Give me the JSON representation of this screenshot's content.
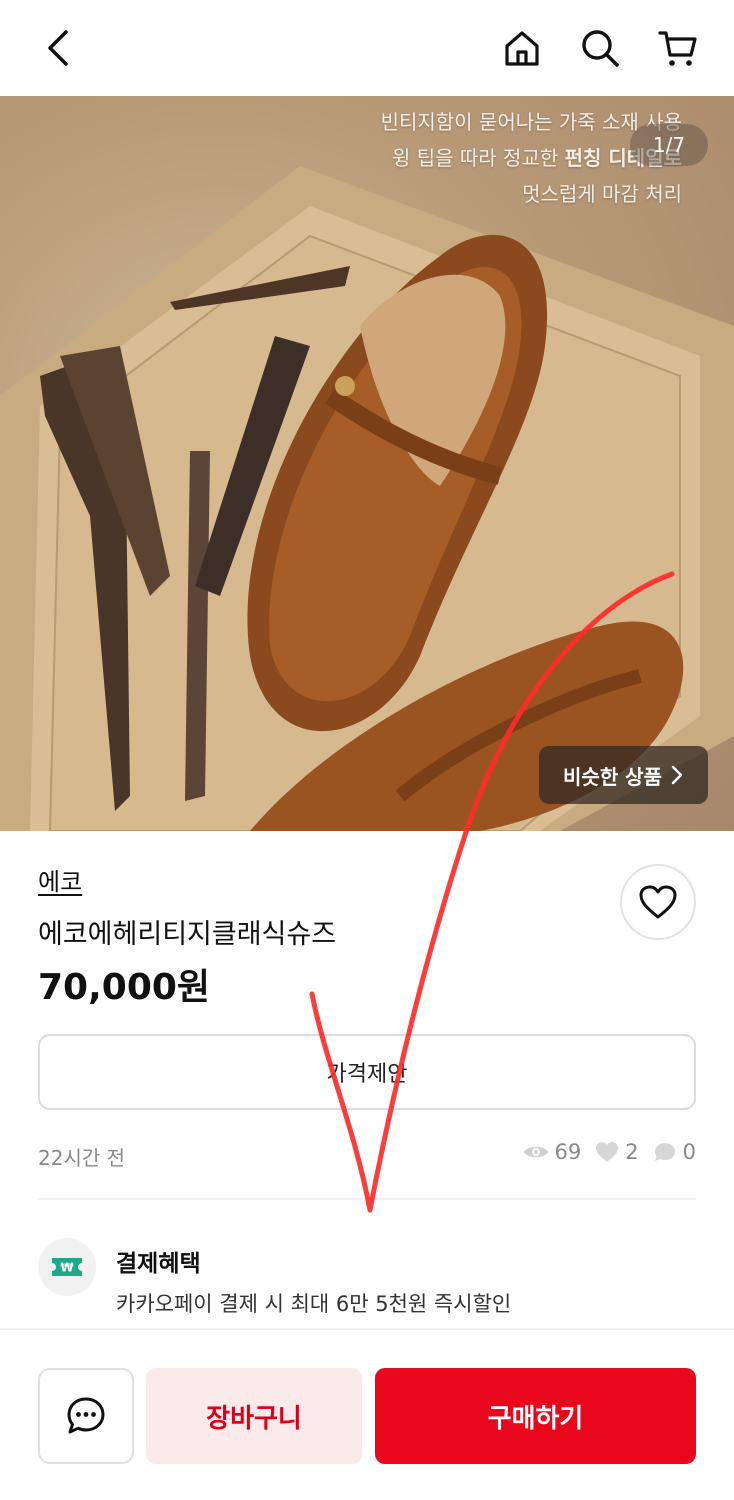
{
  "header": {
    "back_icon": "chevron-left-icon",
    "home_icon": "home-icon",
    "search_icon": "search-icon",
    "cart_icon": "cart-icon"
  },
  "hero": {
    "overlay_lines": [
      "빈티지함이 묻어나는 가죽 소재 사용",
      "윙 팁을 따라 정교한",
      "펀칭 디테일로",
      "멋스럽게 마감 처리"
    ],
    "counter": "1/7",
    "similar_label": "비슷한 상품"
  },
  "product": {
    "brand": "에코",
    "title": "에코에헤리티지클래식슈즈",
    "price": "70,000원",
    "offer_label": "가격제안",
    "posted": "22시간 전",
    "views": "69",
    "likes": "2",
    "chats": "0"
  },
  "benefit": {
    "title": "결제혜택",
    "description": "카카오페이 결제 시 최대 6만 5천원 즉시할인",
    "icon_symbol": "₩"
  },
  "bottom": {
    "cart_label": "장바구니",
    "buy_label": "구매하기"
  },
  "colors": {
    "accent": "#e8071c",
    "accent_soft": "#fbeaea",
    "benefit_icon": "#1fa98a"
  }
}
